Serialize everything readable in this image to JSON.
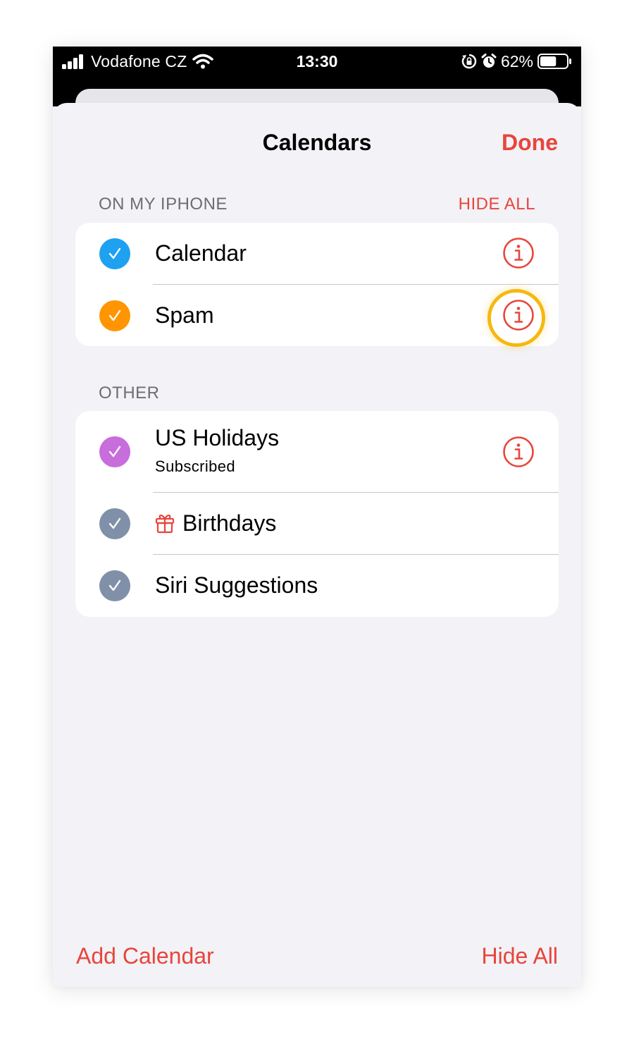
{
  "status_bar": {
    "carrier": "Vodafone CZ",
    "time": "13:30",
    "battery": "62%",
    "battery_level": 0.62
  },
  "nav": {
    "title": "Calendars",
    "done": "Done"
  },
  "sections": [
    {
      "header": "ON MY IPHONE",
      "action": "HIDE ALL",
      "rows": [
        {
          "label": "Calendar",
          "color": "#1ea1f1",
          "checked": true,
          "info": true
        },
        {
          "label": "Spam",
          "color": "#ff9500",
          "checked": true,
          "info": true,
          "highlighted": true
        }
      ]
    },
    {
      "header": "OTHER",
      "rows": [
        {
          "label": "US Holidays",
          "sublabel": "Subscribed",
          "color": "#c86ddc",
          "checked": true,
          "info": true
        },
        {
          "label": "Birthdays",
          "color": "#8090a8",
          "checked": true,
          "icon": "gift-icon"
        },
        {
          "label": "Siri Suggestions",
          "color": "#8090a8",
          "checked": true
        }
      ]
    }
  ],
  "toolbar": {
    "add_calendar": "Add Calendar",
    "hide_all": "Hide All"
  },
  "colors": {
    "accent": "#e8453c",
    "highlight": "#f6b810",
    "background": "#f2f2f7"
  }
}
